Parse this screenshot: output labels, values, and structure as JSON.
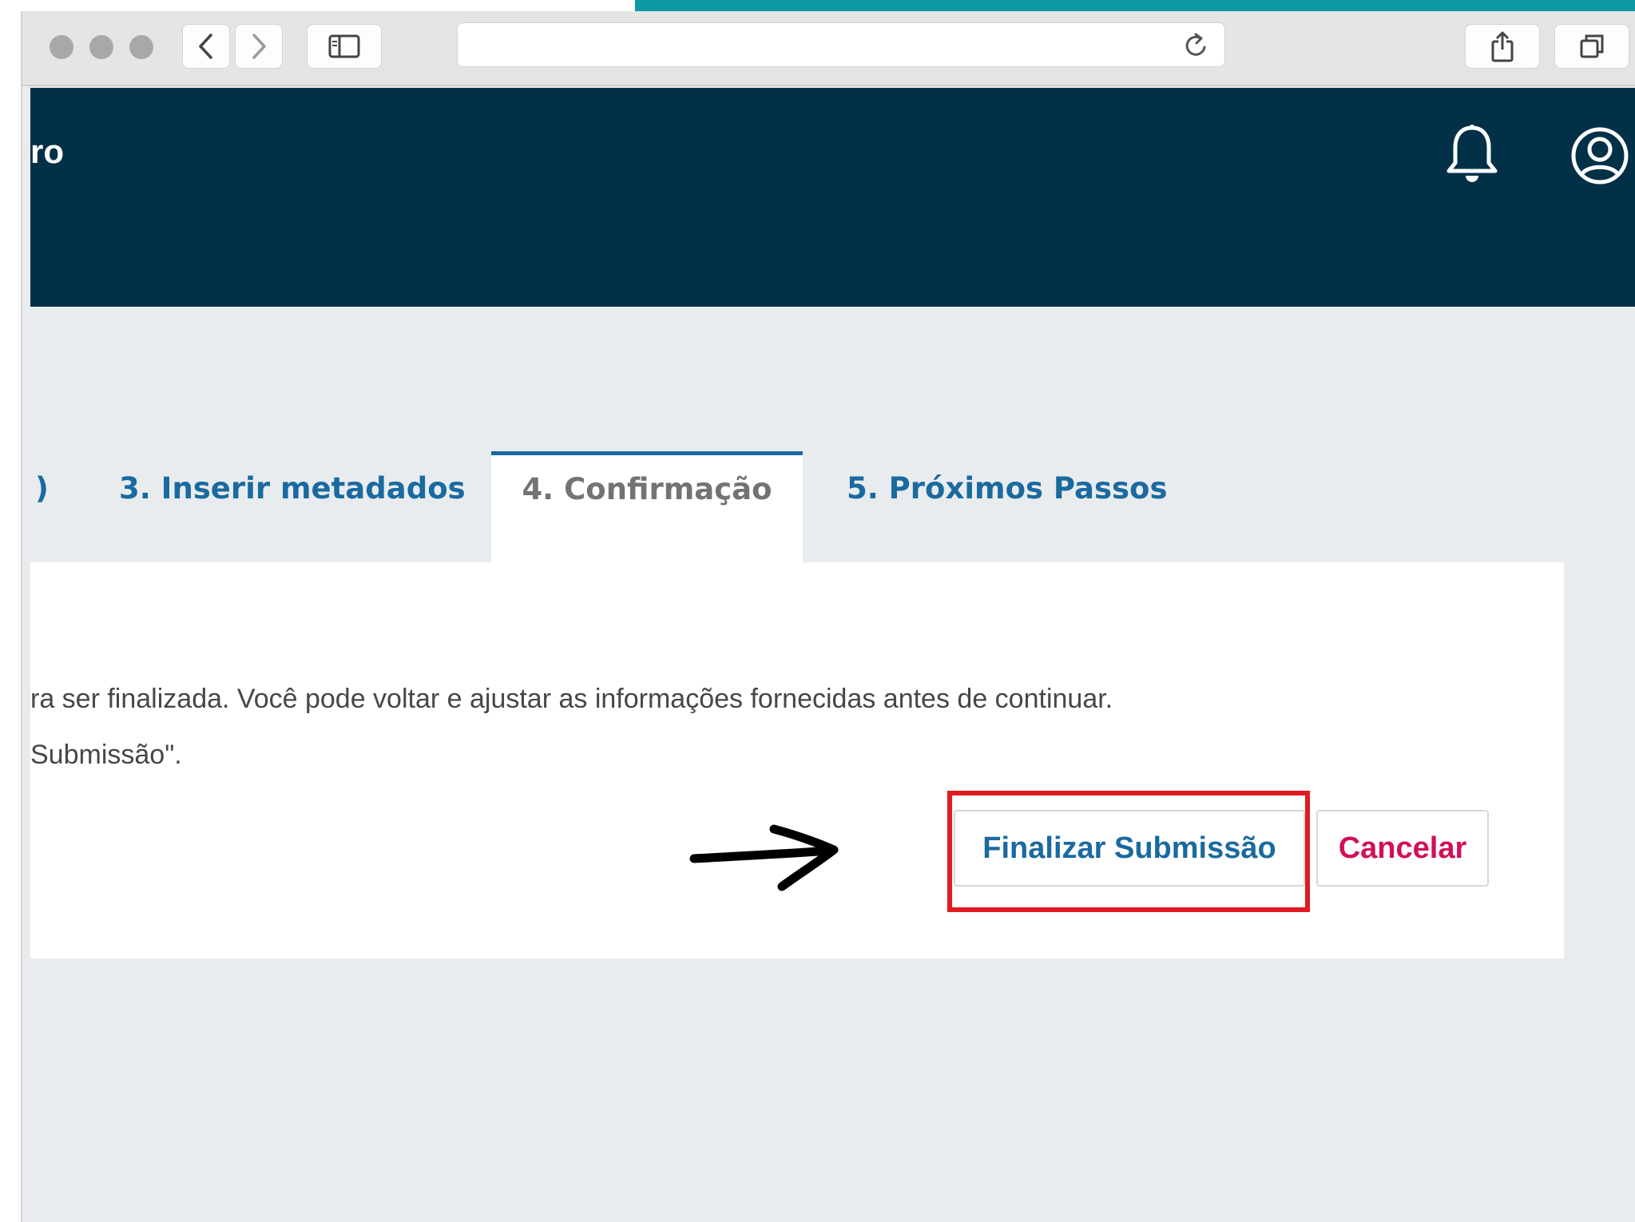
{
  "app": {
    "title_fragment": "ro"
  },
  "tabs": [
    {
      "label": "3. Inserir metadados",
      "active": false
    },
    {
      "label": "4. Confirmação",
      "active": true
    },
    {
      "label": "5. Próximos Passos",
      "active": false
    }
  ],
  "tab_partial_glyph": ")",
  "message": {
    "line1": "ra ser finalizada. Você pode voltar e ajustar as informações fornecidas antes de continuar.",
    "line2": " Submissão\"."
  },
  "actions": {
    "finalize_label": "Finalizar Submissão",
    "cancel_label": "Cancelar"
  },
  "colors": {
    "header_bg": "#023147",
    "tab_link": "#1a6aa0",
    "cancel": "#d0105a",
    "highlight": "#e11b22"
  },
  "icons": {
    "notifications": "bell-icon",
    "account": "user-circle-icon",
    "annotation": "arrow-right-icon"
  }
}
